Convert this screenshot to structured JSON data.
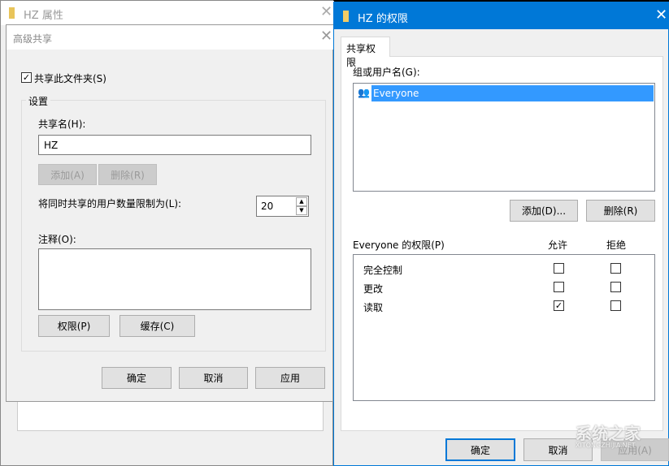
{
  "props_window": {
    "title": "HZ 属性"
  },
  "advanced": {
    "title": "高级共享",
    "share_checkbox": "共享此文件夹(S)",
    "share_checked": true,
    "group": "设置",
    "share_name_label": "共享名(H):",
    "share_name_value": "HZ",
    "add": "添加(A)",
    "remove": "删除(R)",
    "limit_label": "将同时共享的用户数量限制为(L):",
    "limit_value": "20",
    "comment_label": "注释(O):",
    "comment_value": "",
    "permissions": "权限(P)",
    "cache": "缓存(C)",
    "ok": "确定",
    "cancel": "取消",
    "apply": "应用"
  },
  "perm": {
    "title": "HZ 的权限",
    "tab": "共享权限",
    "group_label": "组或用户名(G):",
    "users": [
      {
        "name": "Everyone",
        "icon": "users-icon",
        "selected": true
      }
    ],
    "add": "添加(D)...",
    "remove": "删除(R)",
    "perm_label": "Everyone 的权限(P)",
    "allow": "允许",
    "deny": "拒绝",
    "rows": [
      {
        "name": "完全控制",
        "allow": false,
        "deny": false
      },
      {
        "name": "更改",
        "allow": false,
        "deny": false
      },
      {
        "name": "读取",
        "allow": true,
        "deny": false
      }
    ],
    "ok": "确定",
    "cancel": "取消",
    "apply": "应用(A)"
  },
  "watermark": {
    "text": "系统之家",
    "sub": "XITONGZHIJIA.NET"
  },
  "colors": {
    "accent": "#0078d7",
    "selection": "#3399ff"
  }
}
